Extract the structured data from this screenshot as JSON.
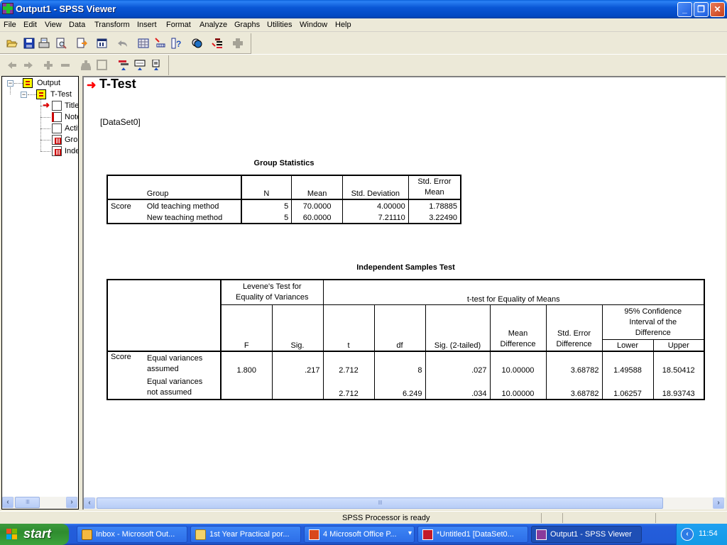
{
  "window": {
    "title": "Output1 - SPSS Viewer",
    "controls": {
      "minimize": "_",
      "restore": "❐",
      "close": "✕"
    }
  },
  "menubar": [
    "File",
    "Edit",
    "View",
    "Data",
    "Transform",
    "Insert",
    "Format",
    "Analyze",
    "Graphs",
    "Utilities",
    "Window",
    "Help"
  ],
  "toolbar1": [
    "open-icon",
    "save-icon",
    "print-icon",
    "print-preview-icon",
    "export-icon",
    "recall-dialog-icon",
    "undo-icon",
    "goto-data-icon",
    "goto-case-icon",
    "variables-icon",
    "use-sets-icon",
    "designate-window-icon",
    "add-icon"
  ],
  "toolbar2": [
    "promote-icon",
    "demote-icon",
    "expand-icon",
    "collapse-icon",
    "show-icon",
    "hide-icon",
    "insert-heading-icon",
    "insert-title-icon",
    "insert-text-icon"
  ],
  "outline": {
    "items": [
      {
        "label": "Output",
        "level": 0,
        "icon": "book-icon",
        "expanded": true
      },
      {
        "label": "T-Test",
        "level": 1,
        "icon": "book-icon",
        "expanded": true
      },
      {
        "label": "Title",
        "level": 2,
        "icon": "title-icon",
        "current": true
      },
      {
        "label": "Notes",
        "level": 2,
        "icon": "notes-icon"
      },
      {
        "label": "Active Dataset",
        "level": 2,
        "icon": "text-icon"
      },
      {
        "label": "Group Statistics",
        "level": 2,
        "icon": "table-icon"
      },
      {
        "label": "Independent Samples Test",
        "level": 2,
        "icon": "table-icon"
      }
    ]
  },
  "content": {
    "heading": "T-Test",
    "dataset": "[DataSet0]",
    "group_statistics": {
      "title": "Group Statistics",
      "headers": [
        "",
        "Group",
        "N",
        "Mean",
        "Std. Deviation",
        "Std. Error Mean"
      ],
      "header_std_error_line1": "Std. Error",
      "header_std_error_line2": "Mean",
      "rows": [
        {
          "variable": "Score",
          "group": "Old teaching method",
          "n": "5",
          "mean": "70.0000",
          "sd": "4.00000",
          "se": "1.78885"
        },
        {
          "variable": "",
          "group": "New teaching method",
          "n": "5",
          "mean": "60.0000",
          "sd": "7.21110",
          "se": "3.22490"
        }
      ]
    },
    "independent_test": {
      "title": "Independent Samples Test",
      "levene_header_1": "Levene's Test for",
      "levene_header_2": "Equality of Variances",
      "ttest_header": "t-test for Equality of Means",
      "ci_header_1": "95% Confidence",
      "ci_header_2": "Interval of the",
      "ci_header_3": "Difference",
      "columns": {
        "f": "F",
        "sig": "Sig.",
        "t": "t",
        "df": "df",
        "sig2": "Sig. (2-tailed)",
        "mean_diff_1": "Mean",
        "mean_diff_2": "Difference",
        "se_diff_1": "Std. Error",
        "se_diff_2": "Difference",
        "lower": "Lower",
        "upper": "Upper"
      },
      "variable": "Score",
      "rows": [
        {
          "label_1": "Equal variances",
          "label_2": "assumed",
          "f": "1.800",
          "sig": ".217",
          "t": "2.712",
          "df": "8",
          "sig2": ".027",
          "mean_diff": "10.00000",
          "se_diff": "3.68782",
          "lower": "1.49588",
          "upper": "18.50412"
        },
        {
          "label_1": "Equal variances",
          "label_2": "not assumed",
          "f": "",
          "sig": "",
          "t": "2.712",
          "df": "6.249",
          "sig2": ".034",
          "mean_diff": "10.00000",
          "se_diff": "3.68782",
          "lower": "1.06257",
          "upper": "18.93743"
        }
      ]
    }
  },
  "scroll": {
    "left": "‹",
    "right": "›",
    "grip": "IIII"
  },
  "statusbar": {
    "text": "SPSS Processor is ready"
  },
  "taskbar": {
    "start": "start",
    "tasks": [
      {
        "label": "Inbox - Microsoft Out...",
        "icon": "outlook-icon"
      },
      {
        "label": "1st Year Practical por...",
        "icon": "folder-icon"
      },
      {
        "label": "4 Microsoft Office P...",
        "icon": "powerpoint-icon",
        "group_arrow": "▾"
      },
      {
        "label": "*Untitled1 [DataSet0...",
        "icon": "spss-data-icon"
      },
      {
        "label": "Output1 - SPSS Viewer",
        "icon": "spss-viewer-icon",
        "active": true
      }
    ],
    "tray_chevron": "‹",
    "clock": "11:54"
  }
}
